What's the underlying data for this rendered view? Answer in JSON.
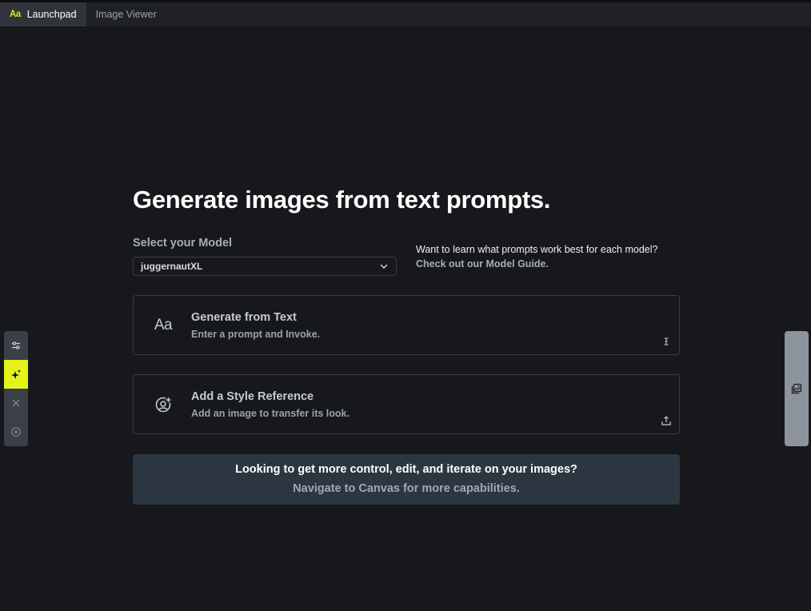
{
  "tabs": [
    {
      "icon": "text-aa-icon",
      "label": "Launchpad",
      "active": true
    },
    {
      "label": "Image Viewer",
      "active": false
    }
  ],
  "launchpad": {
    "title": "Generate images from text prompts.",
    "model_label": "Select your Model",
    "selected_model": "juggernautXL",
    "guide_text": "Want to learn what prompts work best for each model?",
    "guide_link": "Check out our Model Guide."
  },
  "cards": [
    {
      "icon": "text-aa-icon",
      "icon_text": "Aa",
      "title": "Generate from Text",
      "subtitle": "Enter a prompt and Invoke.",
      "corner_icon": "text-cursor-icon"
    },
    {
      "icon": "user-circle-plus-icon",
      "title": "Add a Style Reference",
      "subtitle": "Add an image to transfer its look.",
      "corner_icon": "upload-icon"
    }
  ],
  "canvas_banner": {
    "title": "Looking to get more control, edit, and iterate on your images?",
    "link": "Navigate to Canvas for more capabilities."
  },
  "left_toolbar": [
    {
      "icon": "sliders-icon",
      "active": false
    },
    {
      "icon": "sparkle-invoke-icon",
      "active": true
    },
    {
      "icon": "close-icon",
      "active": false
    },
    {
      "icon": "cancel-circle-icon",
      "active": false
    }
  ],
  "right_toolbar": {
    "icon": "gallery-images-icon"
  },
  "colors": {
    "background": "#17181c",
    "accent": "#e4f31a",
    "banner": "#2b3640"
  }
}
